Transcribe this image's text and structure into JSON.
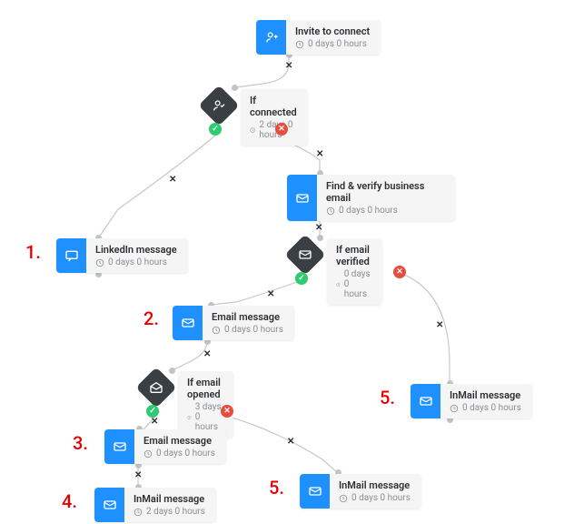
{
  "nodes": {
    "invite": {
      "title": "Invite to connect",
      "delay": "0 days 0 hours"
    },
    "ifConnected": {
      "title": "If connected",
      "delay": "2 days 0 hours"
    },
    "linkedinMsg": {
      "title": "LinkedIn message",
      "delay": "0 days 0 hours"
    },
    "findEmail": {
      "title": "Find & verify business email",
      "delay": "0 days 0 hours"
    },
    "ifVerified": {
      "title": "If email verified",
      "delay": "0 days 0 hours"
    },
    "emailMsg1": {
      "title": "Email message",
      "delay": "0 days 0 hours"
    },
    "ifOpened": {
      "title": "If email opened",
      "delay": "3 days 0 hours"
    },
    "emailMsg2": {
      "title": "Email message",
      "delay": "0 days 0 hours"
    },
    "inmail1": {
      "title": "InMail message",
      "delay": "2 days 0 hours"
    },
    "inmail2": {
      "title": "InMail message",
      "delay": "0 days 0 hours"
    },
    "inmail3": {
      "title": "InMail message",
      "delay": "0 days 0 hours"
    }
  },
  "annotations": {
    "a1": "1.",
    "a2": "2.",
    "a3": "3.",
    "a4": "4.",
    "a5": "5.",
    "a5b": "5."
  },
  "icons": {
    "invite": "person-plus-icon",
    "condition": "person-check-icon",
    "message": "message-icon",
    "email": "envelope-icon",
    "emailOpen": "envelope-open-icon"
  },
  "colors": {
    "accent": "#1e90ff",
    "condition": "#3a3f44",
    "ok": "#2ecc71",
    "fail": "#e74c3c",
    "ann": "#e60000"
  }
}
